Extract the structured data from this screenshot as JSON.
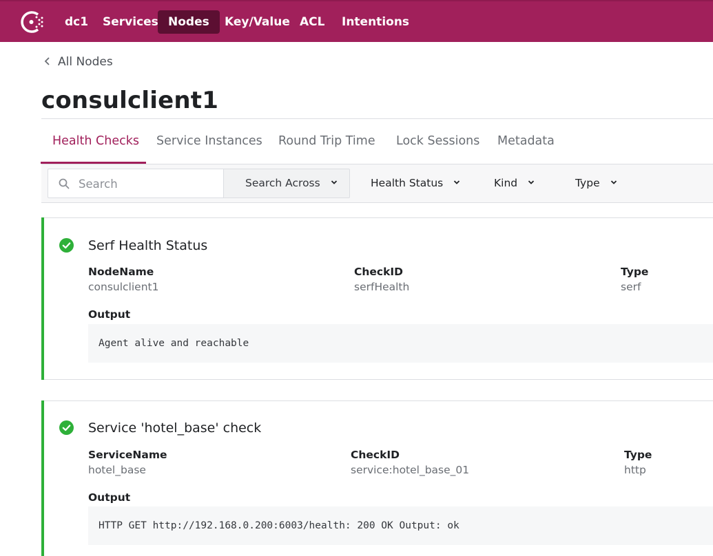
{
  "brand": {
    "accent": "#a1205b",
    "accent_dark": "#5c0f32",
    "passing": "#2eb039"
  },
  "nav": {
    "logo_icon": "consul-logo-icon",
    "items": [
      {
        "label": "dc1",
        "active": false
      },
      {
        "label": "Services",
        "active": false
      },
      {
        "label": "Nodes",
        "active": true
      },
      {
        "label": "Key/Value",
        "active": false
      },
      {
        "label": "ACL",
        "active": false
      },
      {
        "label": "Intentions",
        "active": false
      }
    ]
  },
  "breadcrumb": {
    "icon": "chevron-left-icon",
    "label": "All Nodes"
  },
  "page": {
    "title": "consulclient1"
  },
  "tabs": [
    {
      "label": "Health Checks",
      "active": true
    },
    {
      "label": "Service Instances",
      "active": false
    },
    {
      "label": "Round Trip Time",
      "active": false
    },
    {
      "label": "Lock Sessions",
      "active": false
    },
    {
      "label": "Metadata",
      "active": false
    }
  ],
  "filters": {
    "search_placeholder": "Search",
    "search_value": "",
    "search_across_label": "Search Across",
    "health_status_label": "Health Status",
    "kind_label": "Kind",
    "type_label": "Type"
  },
  "checks": [
    {
      "status": "passing",
      "status_icon": "check-circle-icon",
      "title": "Serf Health Status",
      "fields": [
        {
          "label": "NodeName",
          "value": "consulclient1"
        },
        {
          "label": "CheckID",
          "value": "serfHealth"
        },
        {
          "label": "Type",
          "value": "serf"
        }
      ],
      "output_label": "Output",
      "output": "Agent alive and reachable"
    },
    {
      "status": "passing",
      "status_icon": "check-circle-icon",
      "title": "Service 'hotel_base' check",
      "fields": [
        {
          "label": "ServiceName",
          "value": "hotel_base"
        },
        {
          "label": "CheckID",
          "value": "service:hotel_base_01"
        },
        {
          "label": "Type",
          "value": "http"
        }
      ],
      "output_label": "Output",
      "output": "HTTP GET http://192.168.0.200:6003/health: 200 OK Output: ok"
    }
  ]
}
